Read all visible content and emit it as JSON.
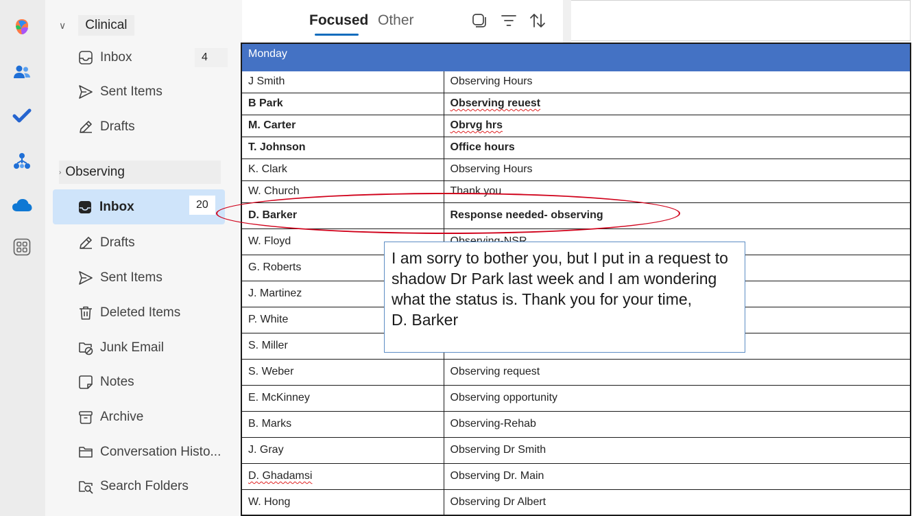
{
  "rail": {
    "apps": [
      {
        "name": "copilot-icon",
        "color": "#8a5cf6"
      },
      {
        "name": "people-icon",
        "color": "#1f6fd6"
      },
      {
        "name": "todo-icon",
        "color": "#2564cf"
      },
      {
        "name": "org-explorer-icon",
        "color": "#1f6fd6"
      },
      {
        "name": "onedrive-icon",
        "color": "#0f78d4"
      },
      {
        "name": "more-apps-icon",
        "color": "#616161"
      }
    ]
  },
  "folders": {
    "clinical": {
      "label": "Clinical",
      "items": [
        {
          "label": "Inbox",
          "count": "4",
          "icon": "inbox-icon"
        },
        {
          "label": "Sent Items",
          "icon": "send-icon"
        },
        {
          "label": "Drafts",
          "icon": "drafts-icon"
        }
      ]
    },
    "observing": {
      "label": "Observing",
      "items": [
        {
          "label": "Inbox",
          "count": "20",
          "icon": "inbox-icon",
          "selected": true
        },
        {
          "label": "Drafts",
          "icon": "drafts-icon"
        },
        {
          "label": "Sent Items",
          "icon": "send-icon"
        },
        {
          "label": "Deleted Items",
          "icon": "trash-icon"
        },
        {
          "label": "Junk Email",
          "icon": "junk-icon"
        },
        {
          "label": "Notes",
          "icon": "notes-icon"
        },
        {
          "label": "Archive",
          "icon": "archive-icon"
        },
        {
          "label": "Conversation Histo...",
          "icon": "folder-icon"
        },
        {
          "label": "Search Folders",
          "icon": "search-folder-icon"
        }
      ]
    }
  },
  "toolbar": {
    "focused_label": "Focused",
    "other_label": "Other"
  },
  "table": {
    "header": [
      "Monday",
      ""
    ],
    "rows": [
      {
        "sender": "J Smith",
        "subject": "Observing Hours",
        "bold": false
      },
      {
        "sender": "B Park",
        "subject": "Observing reuest",
        "bold": true
      },
      {
        "sender": "M. Carter",
        "subject": "Obrvg hrs",
        "bold": true
      },
      {
        "sender": "T. Johnson",
        "subject": "Office hours",
        "bold": true
      },
      {
        "sender": "K. Clark",
        "subject": "Observing Hours",
        "bold": false
      },
      {
        "sender": "W. Church",
        "subject": "Thank you",
        "bold": false
      },
      {
        "sender": "D. Barker",
        "subject": "Response needed- observing",
        "bold": true
      },
      {
        "sender": "W. Floyd",
        "subject": "Observing-NSR",
        "bold": false
      },
      {
        "sender": "G. Roberts",
        "subject": "",
        "bold": false
      },
      {
        "sender": "J. Martinez",
        "subject": "",
        "bold": false
      },
      {
        "sender": "P. White",
        "subject": "",
        "bold": false
      },
      {
        "sender": "S. Miller",
        "subject": "",
        "bold": false
      },
      {
        "sender": "S. Weber",
        "subject": "Observing request",
        "bold": false
      },
      {
        "sender": "E. McKinney",
        "subject": "Observing opportunity",
        "bold": false
      },
      {
        "sender": "B. Marks",
        "subject": "Observing-Rehab",
        "bold": false
      },
      {
        "sender": "J. Gray",
        "subject": "Observing Dr Smith",
        "bold": false
      },
      {
        "sender": "D. Ghadamsi",
        "subject": "Observing Dr. Main",
        "bold": false
      },
      {
        "sender": "W. Hong",
        "subject": "Observing Dr Albert",
        "bold": false
      }
    ]
  },
  "callout": {
    "text": "I am sorry to bother you, but I put in a request to shadow Dr Park last week and I am wondering what the status is. Thank you for your time,\nD. Barker"
  },
  "colors": {
    "header_bg": "#4472c4",
    "selected_folder": "#cfe4fa",
    "accent": "#0f6cbd",
    "highlight_ring": "#d0021b"
  }
}
